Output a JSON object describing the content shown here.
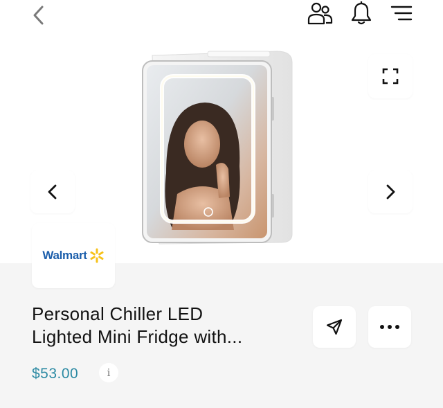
{
  "header": {
    "back_icon": "chevron-left-icon",
    "icons": [
      "people-icon",
      "bell-icon",
      "filter-menu-icon"
    ]
  },
  "gallery": {
    "expand_icon": "expand-icon",
    "prev_icon": "chevron-left-icon",
    "next_icon": "chevron-right-icon"
  },
  "retailer": {
    "name": "Walmart"
  },
  "product": {
    "title_line1": "Personal Chiller LED",
    "title_line2": "Lighted Mini Fridge with...",
    "price": "$53.00",
    "info_label": "i"
  },
  "actions": {
    "share_icon": "send-icon",
    "more_icon": "more-dots-icon"
  },
  "colors": {
    "price": "#2c8aa3",
    "walmart_blue": "#1b5eab",
    "walmart_yellow": "#f7c21a",
    "lower_background": "#f5f5f5"
  }
}
